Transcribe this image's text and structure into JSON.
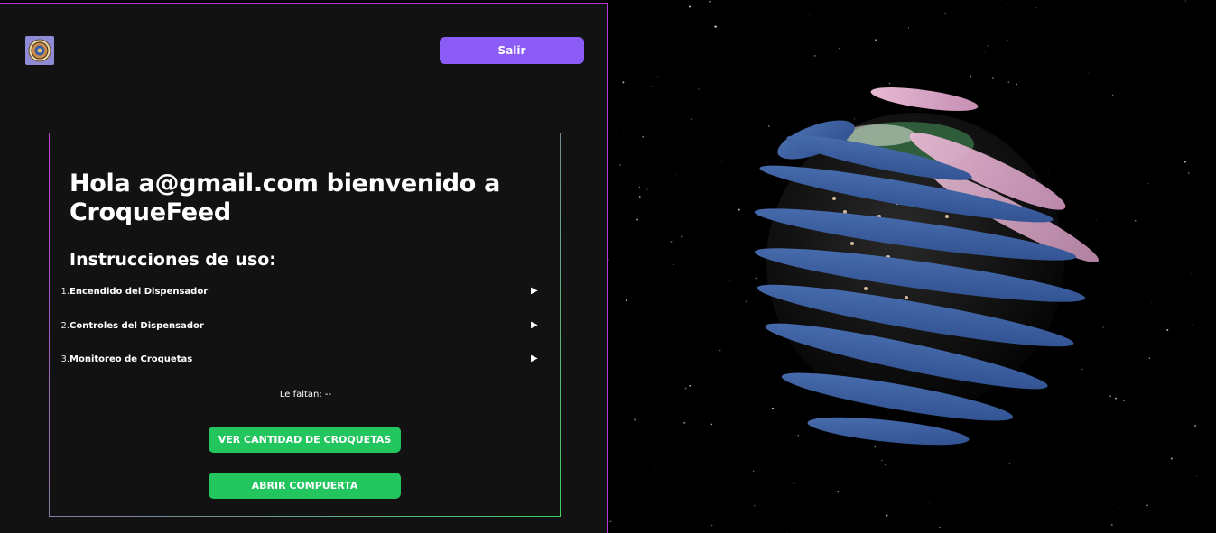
{
  "header": {
    "logout_label": "Salir"
  },
  "card": {
    "greeting": "Hola a@gmail.com bienvenido a CroqueFeed",
    "instructions_title": "Instrucciones de uso:",
    "steps": [
      {
        "number": "1.",
        "label": "Encendido del Dispensador"
      },
      {
        "number": "2.",
        "label": "Controles del Dispensador"
      },
      {
        "number": "3.",
        "label": "Monitoreo de Croquetas"
      }
    ],
    "remaining_text": "Le faltan: --",
    "count_button_label": "VER CANTIDAD DE CROQUETAS",
    "open_button_label": "ABRIR COMPUERTA"
  },
  "icons": {
    "logo": "seal-logo-icon",
    "step_arrow": "triangle-right-icon"
  },
  "colors": {
    "panel_bg": "#121212",
    "accent_purple": "#8b5cf6",
    "accent_green": "#22c55e",
    "border_magenta": "#b13bd6"
  }
}
